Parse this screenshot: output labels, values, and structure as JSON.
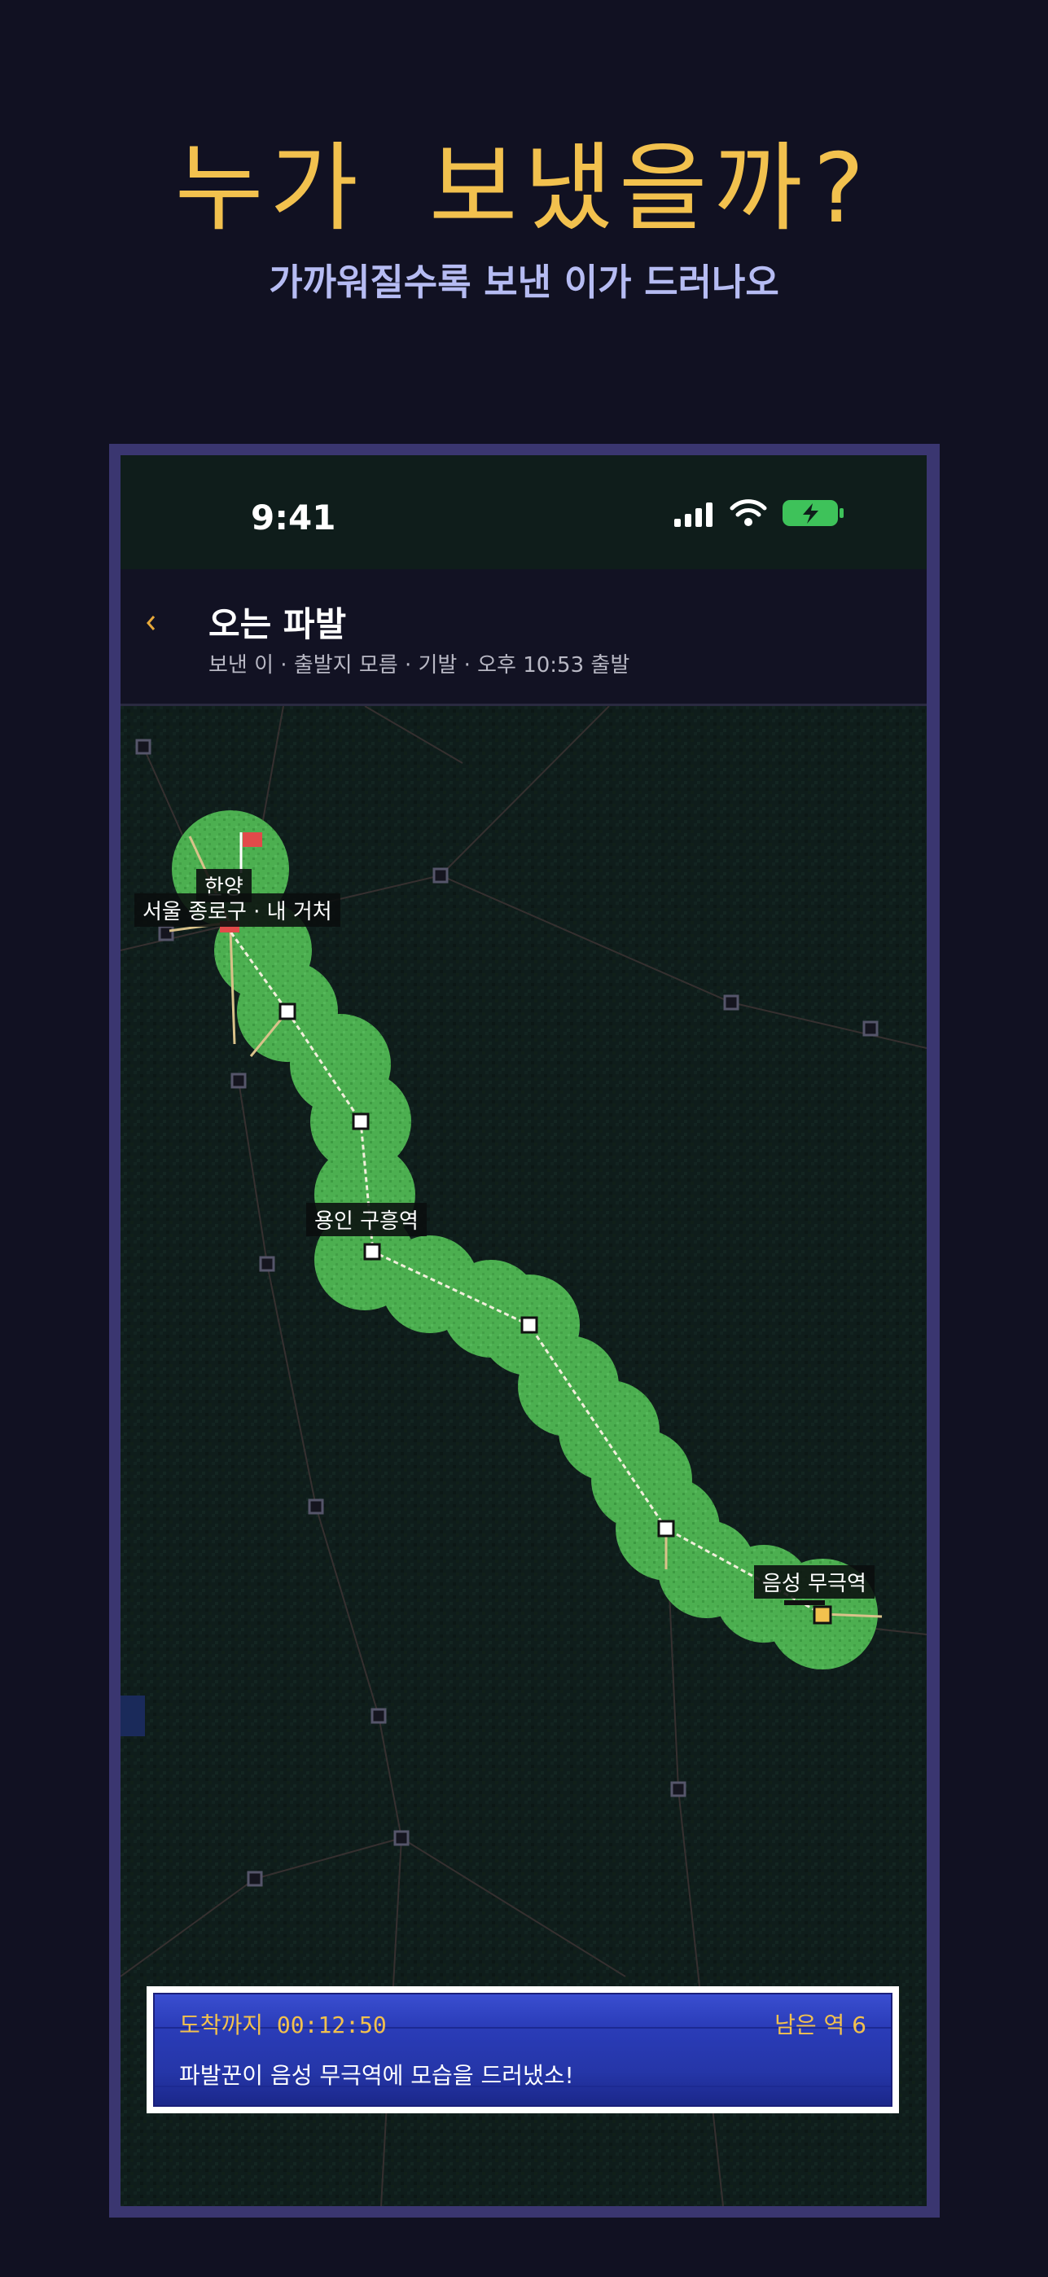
{
  "headline": "누가 보냈을까?",
  "subheadline": "가까워질수록 보낸 이가 드러나오",
  "status_bar": {
    "time": "9:41"
  },
  "nav": {
    "back_icon": "chevron-left-icon",
    "title": "오는 파발",
    "subtitle": "보낸 이 · 출발지 모름 · 기발 · 오후 10:53 출발"
  },
  "map": {
    "labels": {
      "start_station": "한양",
      "my_location": "서울 종로구 · 내 거처",
      "mid_station": "용인 구흥역",
      "current_station": "음성 무극역"
    }
  },
  "dialog": {
    "eta": "도착까지 00:12:50",
    "remaining": "남은 역 6",
    "message": "파발꾼이 음성 무극역에 모습을 드러냈소!"
  },
  "colors": {
    "accent": "#f2c14e",
    "subheadline": "#b6bcf3",
    "route_zone": "#4caf50",
    "dialog_bg": "#2a3cb8"
  }
}
